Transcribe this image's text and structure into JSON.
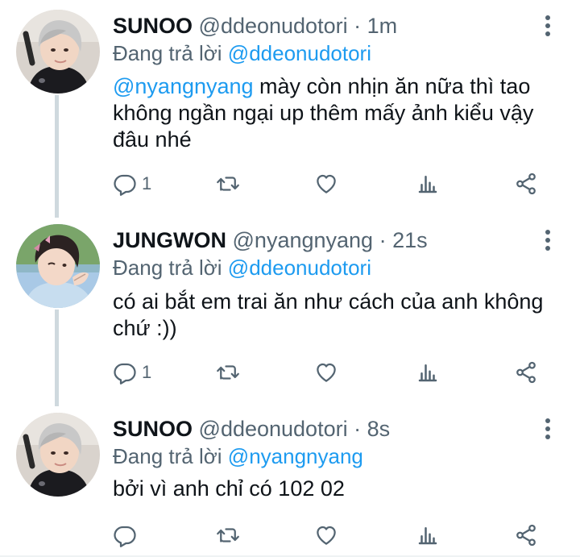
{
  "tweets": [
    {
      "name": "SUNOO",
      "handle": "@ddeonudotori",
      "separator": "·",
      "time": "1m",
      "replying_prefix": "Đang trả lời",
      "replying_to": "@ddeonudotori",
      "mention": "@nyangnyang",
      "text": " mày còn nhịn ăn nữa thì tao không ngần ngại up thêm mấy ảnh kiểu vậy đâu nhé",
      "reply_count": "1"
    },
    {
      "name": "JUNGWON",
      "handle": "@nyangnyang",
      "separator": "·",
      "time": "21s",
      "replying_prefix": "Đang trả lời",
      "replying_to": "@ddeonudotori",
      "text": "có ai bắt em trai ăn như cách của anh không chứ :))",
      "reply_count": "1"
    },
    {
      "name": "SUNOO",
      "handle": "@ddeonudotori",
      "separator": "·",
      "time": "8s",
      "replying_prefix": "Đang trả lời",
      "replying_to": "@nyangnyang",
      "text": "bởi vì anh chỉ có 102 02",
      "reply_count": ""
    }
  ],
  "colors": {
    "link": "#1d9bf0",
    "secondary_text": "#536471",
    "thread_line": "#cfd9de"
  },
  "icons": [
    "reply-icon",
    "retweet-icon",
    "like-icon",
    "views-icon",
    "share-icon",
    "more-icon"
  ]
}
